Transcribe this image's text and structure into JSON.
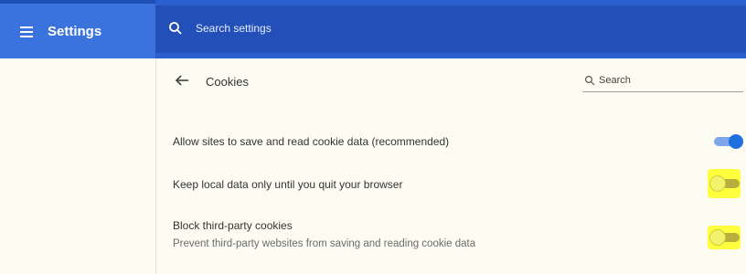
{
  "header": {
    "title": "Settings",
    "search_placeholder": "Search settings"
  },
  "page": {
    "title": "Cookies",
    "search_placeholder": "Search"
  },
  "settings": [
    {
      "label": "Allow sites to save and read cookie data (recommended)",
      "enabled": true
    },
    {
      "label": "Keep local data only until you quit your browser",
      "enabled": false
    },
    {
      "label": "Block third-party cookies",
      "description": "Prevent third-party websites from saving and reading cookie data",
      "enabled": false
    }
  ],
  "colors": {
    "header_blue": "#2b5fcf",
    "toggle_on": "#1f6fe0",
    "highlight": "#ffff3e"
  },
  "icons": [
    "menu-icon",
    "search-icon",
    "back-arrow-icon"
  ]
}
